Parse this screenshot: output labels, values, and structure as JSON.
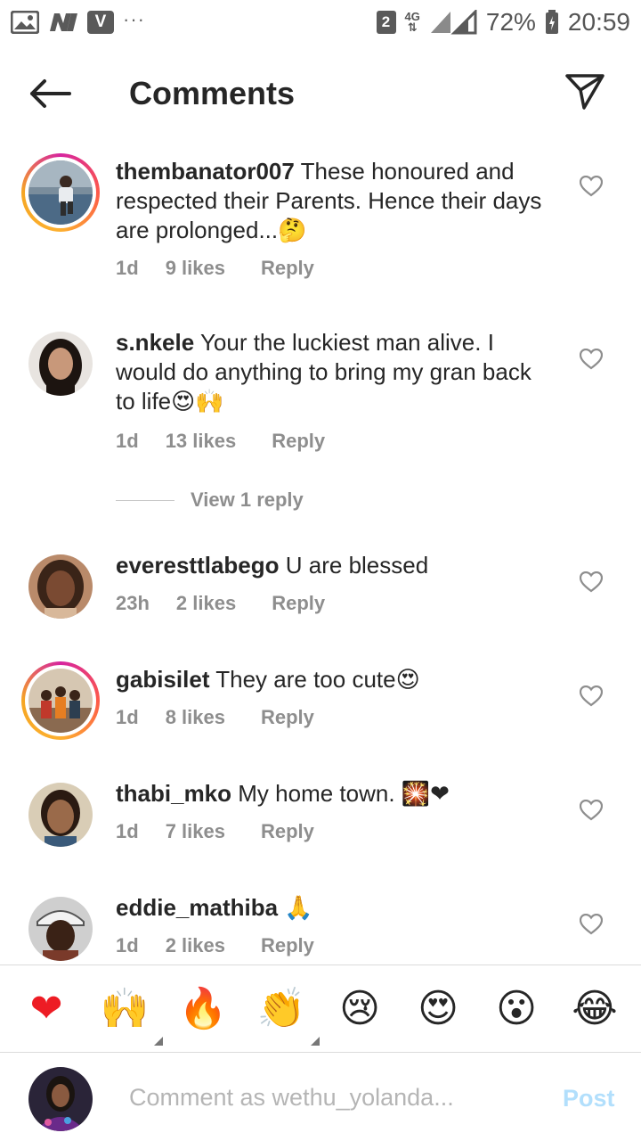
{
  "status_bar": {
    "left_icons": [
      "gallery-icon",
      "n-icon",
      "v-icon"
    ],
    "overflow": "···",
    "sim": "2",
    "network": "4G",
    "battery": "72%",
    "time": "20:59"
  },
  "header": {
    "title": "Comments",
    "back_icon": "arrow-left-icon",
    "share_icon": "send-icon"
  },
  "comments": [
    {
      "user": "thembanator007",
      "text": "These honoured and respected their Parents. Hence their days are prolonged...🤔",
      "age": "1d",
      "likes": "9 likes",
      "reply": "Reply",
      "story_ring": true
    },
    {
      "user": "s.nkele",
      "text": "Your the luckiest man alive. I would do anything to bring my gran back to life😍🙌",
      "age": "1d",
      "likes": "13 likes",
      "reply": "Reply",
      "story_ring": false
    },
    {
      "user": "everesttlabego",
      "text": "U are blessed",
      "age": "23h",
      "likes": "2 likes",
      "reply": "Reply",
      "story_ring": false
    },
    {
      "user": "gabisilet",
      "text": "They are too cute😍",
      "age": "1d",
      "likes": "8 likes",
      "reply": "Reply",
      "story_ring": true
    },
    {
      "user": "thabi_mko",
      "text": "My home town. 🎇❤",
      "age": "1d",
      "likes": "7 likes",
      "reply": "Reply",
      "story_ring": false
    },
    {
      "user": "eddie_mathiba",
      "text": "🙏",
      "age": "1d",
      "likes": "2 likes",
      "reply": "Reply",
      "story_ring": false
    }
  ],
  "view_replies": "View 1 reply",
  "emoji_bar": [
    "❤",
    "🙌",
    "🔥",
    "👏",
    "😢",
    "😍",
    "😮",
    "😂"
  ],
  "composer": {
    "placeholder": "Comment as wethu_yolanda...",
    "post_label": "Post"
  },
  "colors": {
    "text": "#262626",
    "meta": "#8e8e8e",
    "post_disabled": "#b2dffc",
    "story_ring": "#d6249f"
  }
}
